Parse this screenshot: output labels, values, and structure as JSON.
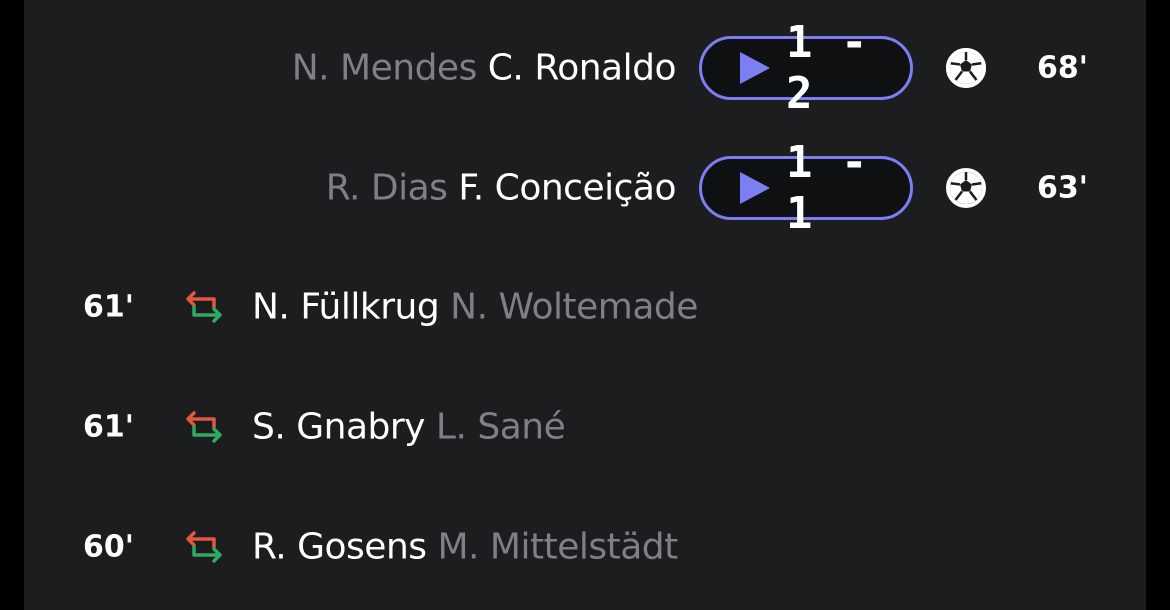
{
  "colors": {
    "background": "#1b1d1f",
    "accent": "#7c7ff2",
    "muted_text": "#7d8084",
    "primary_text": "#ffffff",
    "sub_out_arrow": "#e2573f",
    "sub_in_arrow": "#2faa62"
  },
  "goals": [
    {
      "assist": "N. Mendes",
      "scorer": "C. Ronaldo",
      "score": "1 - 2",
      "icon": "soccer-ball-icon",
      "minute": "68'"
    },
    {
      "assist": "R. Dias",
      "scorer": "F. Conceição",
      "score": "1 - 1",
      "icon": "soccer-ball-icon",
      "minute": "63'"
    }
  ],
  "substitutions": [
    {
      "minute": "61'",
      "icon": "substitution-icon",
      "player_in": "N. Füllkrug",
      "player_out": "N. Woltemade"
    },
    {
      "minute": "61'",
      "icon": "substitution-icon",
      "player_in": "S. Gnabry",
      "player_out": "L. Sané"
    },
    {
      "minute": "60'",
      "icon": "substitution-icon",
      "player_in": "R. Gosens",
      "player_out": "M. Mittelstädt"
    }
  ]
}
